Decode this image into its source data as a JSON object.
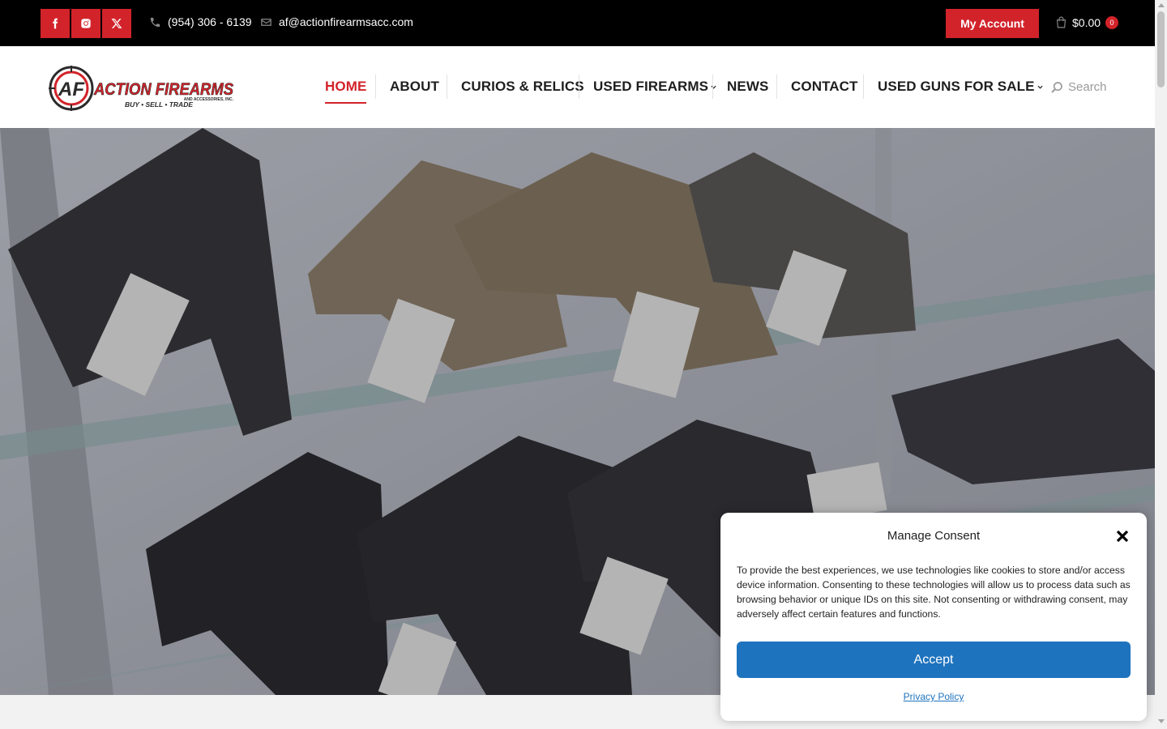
{
  "topbar": {
    "social": [
      {
        "icon": "facebook-icon"
      },
      {
        "icon": "instagram-icon"
      },
      {
        "icon": "x-twitter-icon"
      }
    ],
    "phone": "(954) 306 - 6139",
    "email": "af@actionfirearmsacc.com",
    "account_label": "My Account",
    "cart_total": "$0.00",
    "cart_count": "0"
  },
  "header": {
    "logo": {
      "brand": "ACTION FIREARMS",
      "sub": "AND ACCESSORIES, INC.",
      "tagline": "BUY • SELL • TRADE",
      "monogram": "AF"
    },
    "nav": [
      {
        "label": "HOME",
        "active": true
      },
      {
        "label": "ABOUT"
      },
      {
        "label": "CURIOS & RELICS"
      },
      {
        "label": "USED FIREARMS",
        "has_dropdown": true
      },
      {
        "label": "NEWS"
      },
      {
        "label": "CONTACT"
      },
      {
        "label": "USED GUNS FOR SALE",
        "has_dropdown": true
      }
    ],
    "search_placeholder": "Search"
  },
  "consent": {
    "title": "Manage Consent",
    "body": "To provide the best experiences, we use technologies like cookies to store and/or access device information. Consenting to these technologies will allow us to process data such as browsing behavior or unique IDs on this site. Not consenting or withdrawing consent, may adversely affect certain features and functions.",
    "accept_label": "Accept",
    "privacy_label": "Privacy Policy"
  },
  "colors": {
    "brand_red": "#d2232a",
    "accept_blue": "#1e73be",
    "topbar_bg": "#000000"
  }
}
